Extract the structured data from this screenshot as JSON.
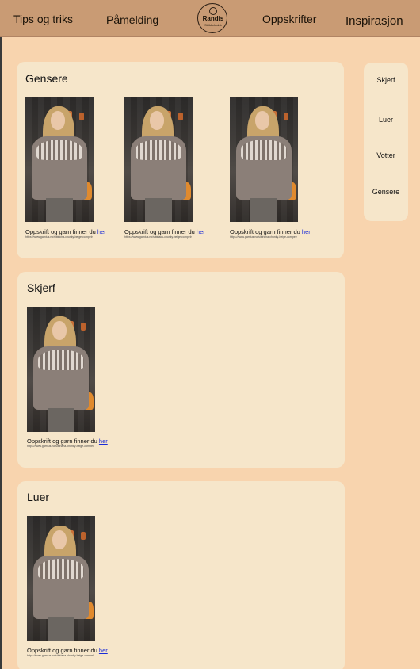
{
  "nav": {
    "items": [
      "Tips og triks",
      "Påmelding",
      "Oppskrifter",
      "Inspirasjon"
    ],
    "logo_title": "Randis",
    "logo_sub": "Strikkeklubb"
  },
  "sidebar": {
    "items": [
      "Skjerf",
      "Luer",
      "Votter",
      "Gensere"
    ]
  },
  "sections": [
    {
      "title": "Gensere",
      "products": [
        {
          "caption": "Oppskrift og garn finner du",
          "link": "her",
          "url": "https://www.garnius.no/sibiricha-chunky-beige-cornpelr"
        },
        {
          "caption": "Oppskrift og garn finner du",
          "link": "her",
          "url": "https://www.garnius.no/sibiriaku-chunky-beige-cornpelr"
        },
        {
          "caption": "Oppskrift og garn finner du",
          "link": "her",
          "url": "https://www.garnius.no/sibiricha-chunky-beige-cornpelr"
        }
      ]
    },
    {
      "title": "Skjerf",
      "products": [
        {
          "caption": "Oppskrift og garn finner du",
          "link": "her",
          "url": "https://www.garnius.no/sibiriana-chunky-beige-cornpelr"
        }
      ]
    },
    {
      "title": "Luer",
      "products": [
        {
          "caption": "Oppskrift og garn finner du",
          "link": "her",
          "url": "https://www.garnius.no/sibiriana-chunky-beige-cornpelr"
        }
      ]
    }
  ],
  "colors": {
    "background": "#f8d4ae",
    "nav": "#c99b74",
    "card": "#f6e6ca",
    "link": "#1a2bd8"
  }
}
